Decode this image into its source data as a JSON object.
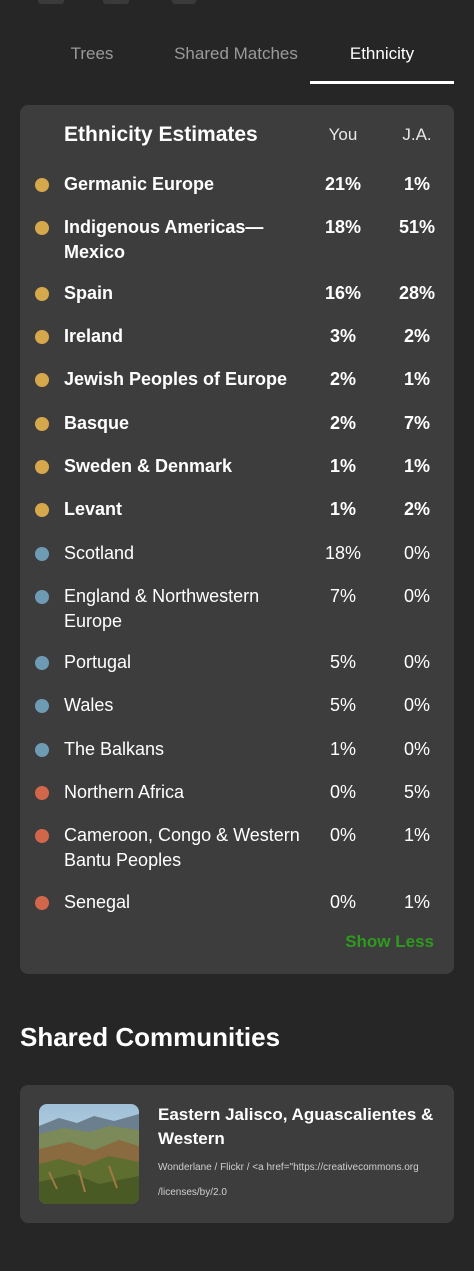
{
  "tabs": [
    {
      "label": "Trees"
    },
    {
      "label": "Shared Matches"
    },
    {
      "label": "Ethnicity"
    }
  ],
  "ethnicity": {
    "title": "Ethnicity Estimates",
    "col_you": "You",
    "col_other": "J.A.",
    "colors": {
      "gold": "#d6a84c",
      "blue": "#6e9bb4",
      "red": "#d2664b"
    },
    "rows": [
      {
        "name": "Germanic Europe",
        "you": "21%",
        "other": "1%",
        "color": "gold",
        "bold": true
      },
      {
        "name": "Indigenous Americas—Mexico",
        "you": "18%",
        "other": "51%",
        "color": "gold",
        "bold": true
      },
      {
        "name": "Spain",
        "you": "16%",
        "other": "28%",
        "color": "gold",
        "bold": true
      },
      {
        "name": "Ireland",
        "you": "3%",
        "other": "2%",
        "color": "gold",
        "bold": true
      },
      {
        "name": "Jewish Peoples of Europe",
        "you": "2%",
        "other": "1%",
        "color": "gold",
        "bold": true
      },
      {
        "name": "Basque",
        "you": "2%",
        "other": "7%",
        "color": "gold",
        "bold": true
      },
      {
        "name": "Sweden & Denmark",
        "you": "1%",
        "other": "1%",
        "color": "gold",
        "bold": true
      },
      {
        "name": "Levant",
        "you": "1%",
        "other": "2%",
        "color": "gold",
        "bold": true
      },
      {
        "name": "Scotland",
        "you": "18%",
        "other": "0%",
        "color": "blue",
        "bold": false
      },
      {
        "name": "England & Northwestern Europe",
        "you": "7%",
        "other": "0%",
        "color": "blue",
        "bold": false
      },
      {
        "name": "Portugal",
        "you": "5%",
        "other": "0%",
        "color": "blue",
        "bold": false
      },
      {
        "name": "Wales",
        "you": "5%",
        "other": "0%",
        "color": "blue",
        "bold": false
      },
      {
        "name": "The Balkans",
        "you": "1%",
        "other": "0%",
        "color": "blue",
        "bold": false
      },
      {
        "name": "Northern Africa",
        "you": "0%",
        "other": "5%",
        "color": "red",
        "bold": false
      },
      {
        "name": "Cameroon, Congo & Western Bantu Peoples",
        "you": "0%",
        "other": "1%",
        "color": "red",
        "bold": false
      },
      {
        "name": "Senegal",
        "you": "0%",
        "other": "1%",
        "color": "red",
        "bold": false
      }
    ],
    "show_less": "Show Less"
  },
  "communities": {
    "section_title": "Shared Communities",
    "card": {
      "title": "Eastern Jalisco, Aguascalientes & Western",
      "credit_line1": "Wonderlane / Flickr / <a href=\"https://creativecommons.org",
      "credit_line2": "/licenses/by/2.0",
      "image": "landscape-photo"
    }
  }
}
